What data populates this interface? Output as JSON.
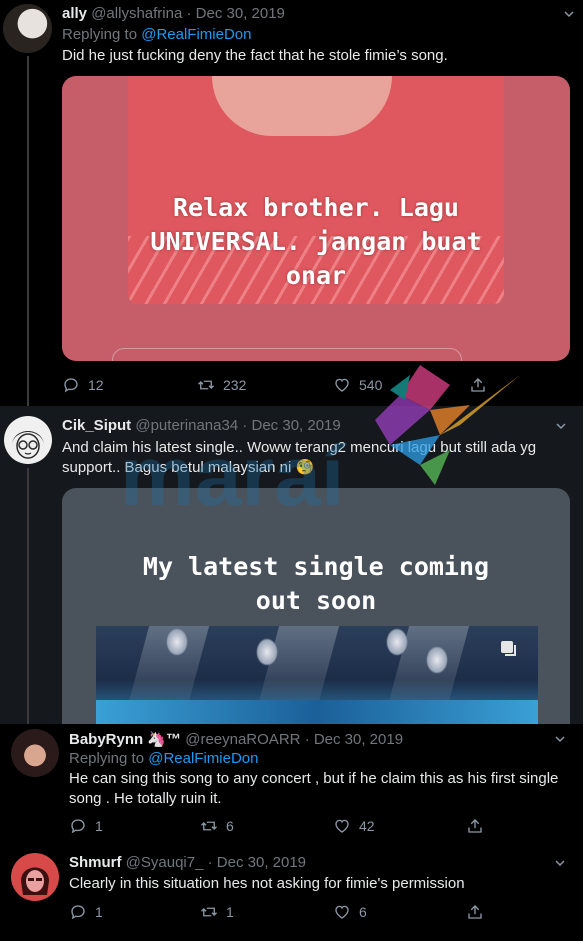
{
  "tweets": [
    {
      "name": "ally",
      "handle": "@allyshafrina",
      "date": "· Dec 30, 2019",
      "replying_prefix": "Replying to",
      "replying_to": "@RealFimieDon",
      "text": "Did he just fucking deny the fact that he stole fimie’s song.",
      "media_caption_line1": "Relax brother. Lagu",
      "media_caption_line2": "UNIVERSAL. jangan buat",
      "media_caption_line3": "onar",
      "replies": "12",
      "retweets": "232",
      "likes": "540"
    },
    {
      "name": "Cik_Siput",
      "handle": "@puterinana34",
      "date": "· Dec 30, 2019",
      "text_line1": "And claim his latest single.. Woww terang2 mencuri lagu but still ada yg",
      "text_line2": "support.. Bagus betul malaysian ni",
      "emoji": "🧐",
      "media_caption_line1": "My latest single coming",
      "media_caption_line2": "out soon"
    },
    {
      "name": "BabyRynn",
      "name_suffix": "🦄™",
      "handle": "@reeynaROARR",
      "date": "· Dec 30, 2019",
      "replying_prefix": "Replying to",
      "replying_to": "@RealFimieDon",
      "text_line1": "He can sing this song to any concert , but if he claim this as his first single",
      "text_line2": "song . He totally ruin it.",
      "replies": "1",
      "retweets": "6",
      "likes": "42"
    },
    {
      "name": "Shmurf",
      "handle": "@Syauqi7_",
      "date": "· Dec 30, 2019",
      "text": "Clearly in this situation hes not asking for fimie's permission",
      "replies": "1",
      "retweets": "1",
      "likes": "6"
    }
  ],
  "watermark": "maraí",
  "colors": {
    "accent": "#1d9bf0",
    "background": "#000000",
    "panel": "#15181c"
  },
  "icons": [
    "reply-icon",
    "retweet-icon",
    "like-icon",
    "share-icon",
    "chevron-down-icon",
    "copy-icon"
  ]
}
